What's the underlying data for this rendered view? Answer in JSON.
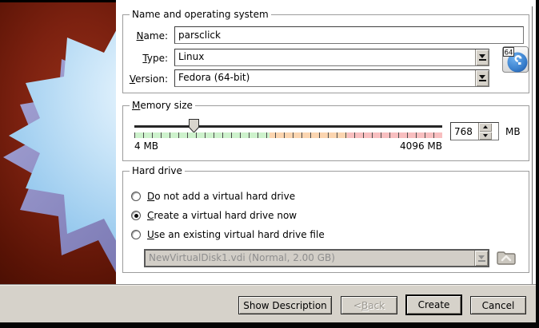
{
  "groups": {
    "os": {
      "title": "Name and operating system",
      "name_label": {
        "key": "N",
        "rest": "ame:"
      },
      "name_value": "parsclick",
      "type_label": {
        "key": "T",
        "rest": "ype:"
      },
      "type_value": "Linux",
      "version_label": {
        "key": "V",
        "rest": "ersion:"
      },
      "version_value": "Fedora (64-bit)",
      "os_icon_badge": "64",
      "os_icon_letter": "f"
    },
    "memory": {
      "title": {
        "key": "M",
        "rest": "emory size"
      },
      "min_label": "4 MB",
      "max_label": "4096 MB",
      "value": "768",
      "unit": "MB"
    },
    "hard_drive": {
      "title": "Hard drive",
      "options": [
        {
          "key": "D",
          "rest": "o not add a virtual hard drive",
          "selected": false
        },
        {
          "key": "C",
          "rest": "reate a virtual hard drive now",
          "selected": true
        },
        {
          "key": "U",
          "rest": "se an existing virtual hard drive file",
          "selected": false
        }
      ],
      "disk_value": "NewVirtualDisk1.vdi (Normal, 2.00 GB)"
    }
  },
  "footer": {
    "show_description": "Show Description",
    "back": {
      "pre": "< ",
      "key": "B",
      "rest": "ack"
    },
    "create": "Create",
    "cancel": "Cancel"
  },
  "colors": {
    "wizard_background_red": "#7c2110",
    "starburst_blue": "#bcdcf5",
    "starburst_side_purple": "#8d8cc4",
    "tick_green": "#cdf2cc",
    "tick_orange": "#fbd5b0",
    "tick_red": "#f8bfc0",
    "chrome_gray": "#d6d2ca",
    "disabled_text": "#8e8e8e"
  }
}
